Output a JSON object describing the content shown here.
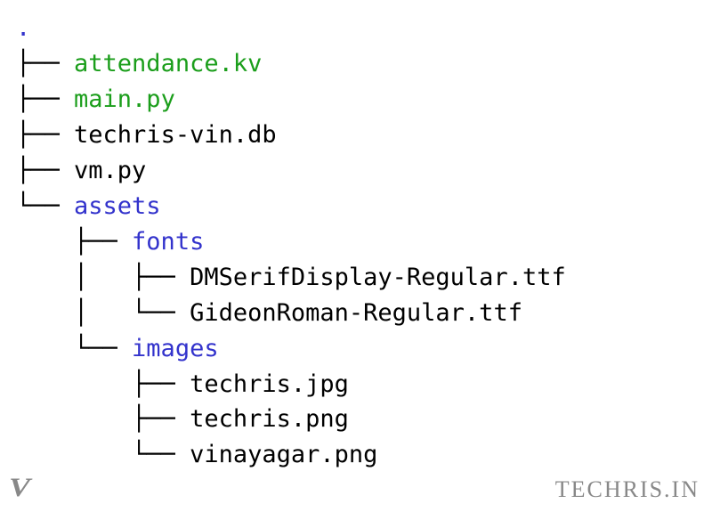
{
  "tree": {
    "root": ".",
    "lines": [
      {
        "prefix": "├── ",
        "name": "attendance.kv",
        "type": "exec"
      },
      {
        "prefix": "├── ",
        "name": "main.py",
        "type": "exec"
      },
      {
        "prefix": "├── ",
        "name": "techris-vin.db",
        "type": "file"
      },
      {
        "prefix": "├── ",
        "name": "vm.py",
        "type": "file"
      },
      {
        "prefix": "└── ",
        "name": "assets",
        "type": "dir"
      },
      {
        "prefix": "    ├── ",
        "name": "fonts",
        "type": "dir"
      },
      {
        "prefix": "    │   ├── ",
        "name": "DMSerifDisplay-Regular.ttf",
        "type": "file"
      },
      {
        "prefix": "    │   └── ",
        "name": "GideonRoman-Regular.ttf",
        "type": "file"
      },
      {
        "prefix": "    └── ",
        "name": "images",
        "type": "dir"
      },
      {
        "prefix": "        ├── ",
        "name": "techris.jpg",
        "type": "file"
      },
      {
        "prefix": "        ├── ",
        "name": "techris.png",
        "type": "file"
      },
      {
        "prefix": "        └── ",
        "name": "vinayagar.png",
        "type": "file"
      }
    ]
  },
  "branding": {
    "logo": "V",
    "text": "TECHRIS.IN"
  }
}
